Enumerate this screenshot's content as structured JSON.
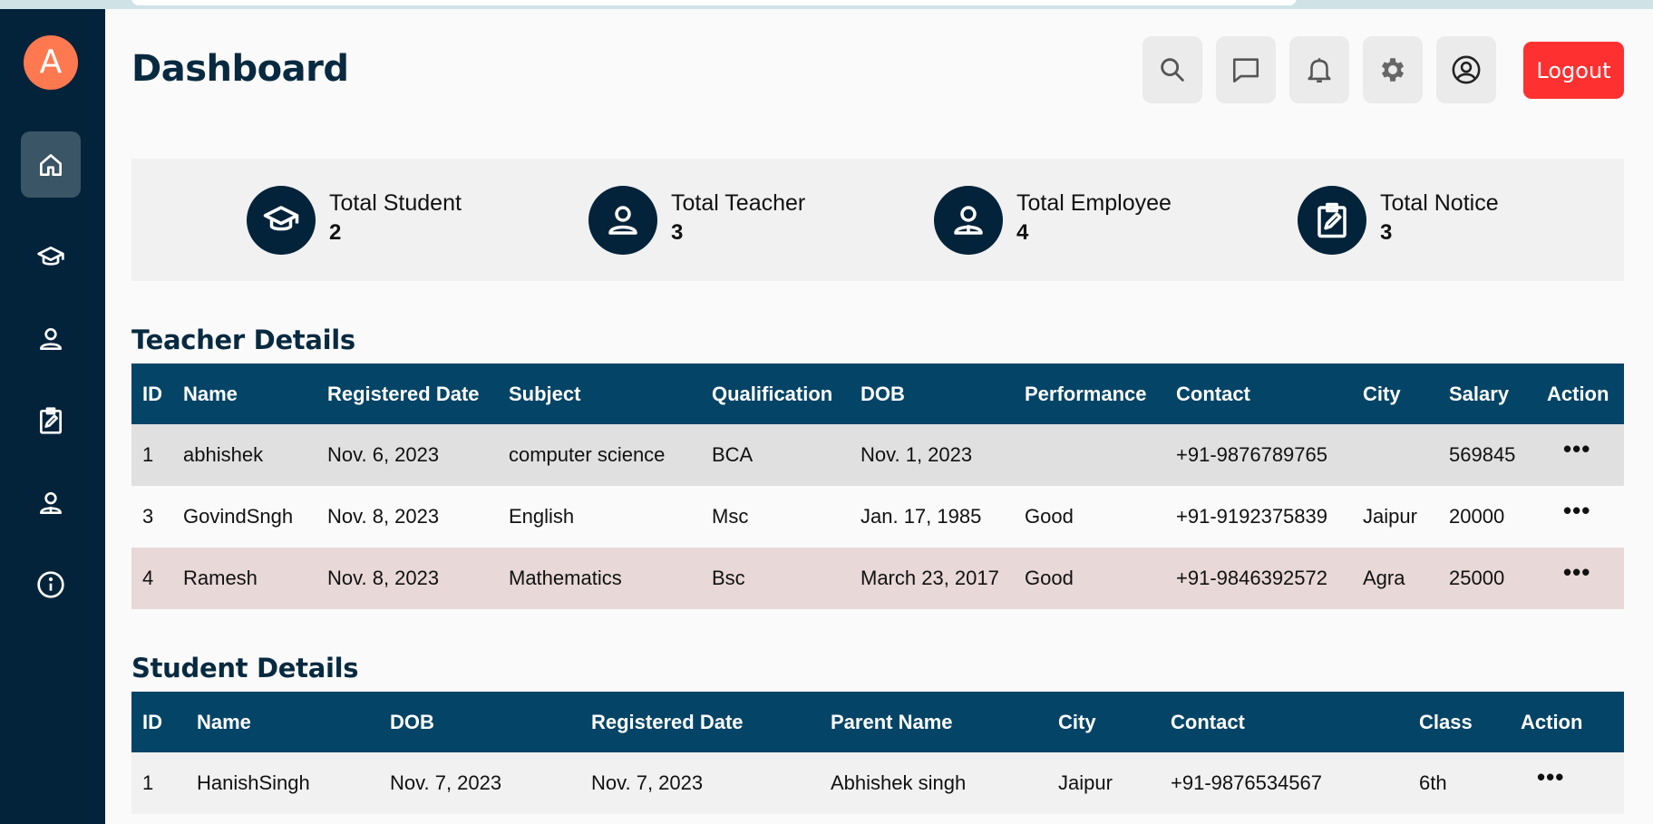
{
  "sidebar": {
    "avatar_letter": "A",
    "items": [
      {
        "name": "home-icon",
        "active": true
      },
      {
        "name": "graduation-cap-icon"
      },
      {
        "name": "person-icon"
      },
      {
        "name": "clipboard-edit-icon"
      },
      {
        "name": "employee-icon"
      },
      {
        "name": "info-icon"
      }
    ]
  },
  "header": {
    "title": "Dashboard",
    "icons": [
      "search-icon",
      "chat-icon",
      "bell-icon",
      "gear-icon",
      "account-icon"
    ],
    "logout_label": "Logout"
  },
  "stats": [
    {
      "label": "Total Student",
      "value": "2",
      "icon": "graduation-cap-icon"
    },
    {
      "label": "Total Teacher",
      "value": "3",
      "icon": "person-icon"
    },
    {
      "label": "Total Employee",
      "value": "4",
      "icon": "employee-icon"
    },
    {
      "label": "Total Notice",
      "value": "3",
      "icon": "clipboard-edit-icon"
    }
  ],
  "teacher_details": {
    "title": "Teacher Details",
    "columns": [
      "ID",
      "Name",
      "Registered Date",
      "Subject",
      "Qualification",
      "DOB",
      "Performance",
      "Contact",
      "City",
      "Salary",
      "Action"
    ],
    "rows": [
      [
        "1",
        "abhishek",
        "Nov. 6, 2023",
        "computer science",
        "BCA",
        "Nov. 1, 2023",
        "",
        "+91-9876789765",
        "",
        "569845",
        "•••"
      ],
      [
        "3",
        "GovindSngh",
        "Nov. 8, 2023",
        "English",
        "Msc",
        "Jan. 17, 1985",
        "Good",
        "+91-9192375839",
        "Jaipur",
        "20000",
        "•••"
      ],
      [
        "4",
        "Ramesh",
        "Nov. 8, 2023",
        "Mathematics",
        "Bsc",
        "March 23, 2017",
        "Good",
        "+91-9846392572",
        "Agra",
        "25000",
        "•••"
      ]
    ]
  },
  "student_details": {
    "title": "Student Details",
    "columns": [
      "ID",
      "Name",
      "DOB",
      "Registered Date",
      "Parent Name",
      "City",
      "Contact",
      "Class",
      "Action"
    ],
    "rows": [
      [
        "1",
        "HanishSingh",
        "Nov. 7, 2023",
        "Nov. 7, 2023",
        "Abhishek singh",
        "Jaipur",
        "+91-9876534567",
        "6th",
        "•••"
      ]
    ]
  },
  "colors": {
    "sidebar": "#02233a",
    "table_header": "#044466",
    "logout": "#ff3030",
    "avatar": "#ff7950"
  }
}
